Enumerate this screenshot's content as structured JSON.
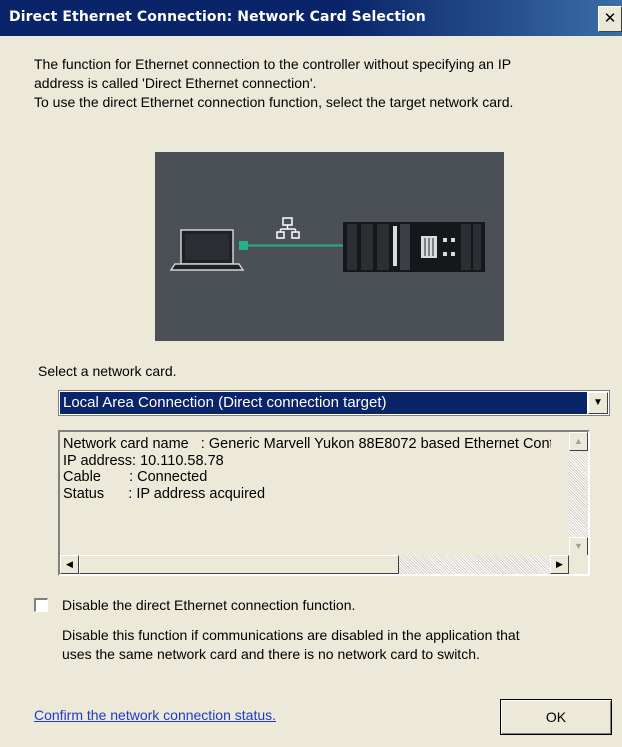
{
  "window": {
    "title": "Direct Ethernet Connection: Network Card Selection",
    "close_glyph": "✕"
  },
  "intro": {
    "line1": "The function for Ethernet connection to the controller without specifying an IP",
    "line2": "address is called 'Direct Ethernet connection'.",
    "line3": "To use the direct Ethernet connection function, select the target network card."
  },
  "diagram": {
    "icons": [
      "laptop-icon",
      "network-icon",
      "controller-icon"
    ],
    "colors": {
      "background": "#4a5056",
      "link": "#27b08a"
    }
  },
  "network_card": {
    "label": "Select a network card.",
    "selected": "Local Area Connection (Direct connection target)",
    "details": "Network card name   : Generic Marvell Yukon 88E8072 based Ethernet Controller\nIP address: 10.110.58.78\nCable       : Connected\nStatus      : IP address acquired"
  },
  "disable_option": {
    "checked": false,
    "label": "Disable the direct Ethernet connection function.",
    "note_line1": "Disable this function if communications are disabled in the application that",
    "note_line2": "uses the same network card and there is no network card to switch."
  },
  "footer": {
    "link": "Confirm the network connection status.",
    "ok_label": "OK"
  }
}
